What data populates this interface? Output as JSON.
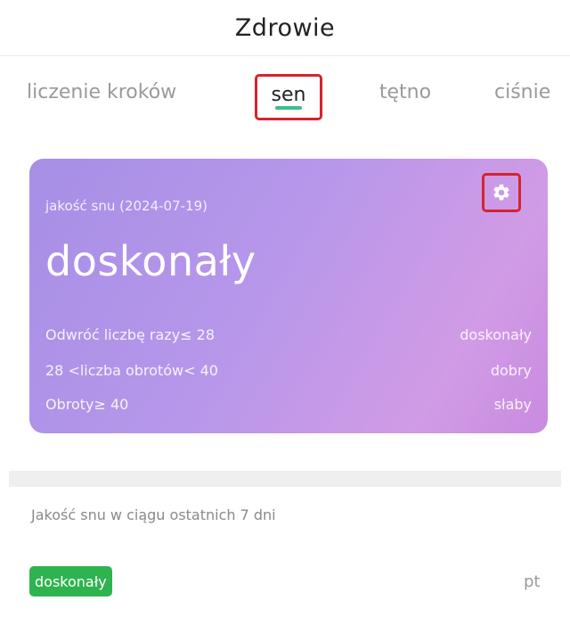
{
  "header": {
    "title": "Zdrowie"
  },
  "tabs": [
    {
      "label": "liczenie kroków",
      "active": false
    },
    {
      "label": "sen",
      "active": true
    },
    {
      "label": "tętno",
      "active": false
    },
    {
      "label": "ciśnie",
      "active": false
    }
  ],
  "card": {
    "subtitle": "jakość snu (2024-07-19)",
    "rating": "doskonały",
    "settings_icon": "gear-icon",
    "legend": [
      {
        "condition": "Odwróć liczbę razy≤ 28",
        "result": "doskonały"
      },
      {
        "condition": "28 <liczba obrotów< 40",
        "result": "dobry"
      },
      {
        "condition": "Obroty≥ 40",
        "result": "słaby"
      }
    ]
  },
  "history": {
    "label": "Jakość snu w ciągu ostatnich 7 dni",
    "entries": [
      {
        "badge": "doskonały",
        "day": "pt"
      }
    ]
  },
  "colors": {
    "accent_green": "#3cc08a",
    "badge_green": "#2fb34f",
    "highlight_red": "#d6232f",
    "card_gradient_start": "#a68fe6",
    "card_gradient_end": "#d19be6"
  }
}
